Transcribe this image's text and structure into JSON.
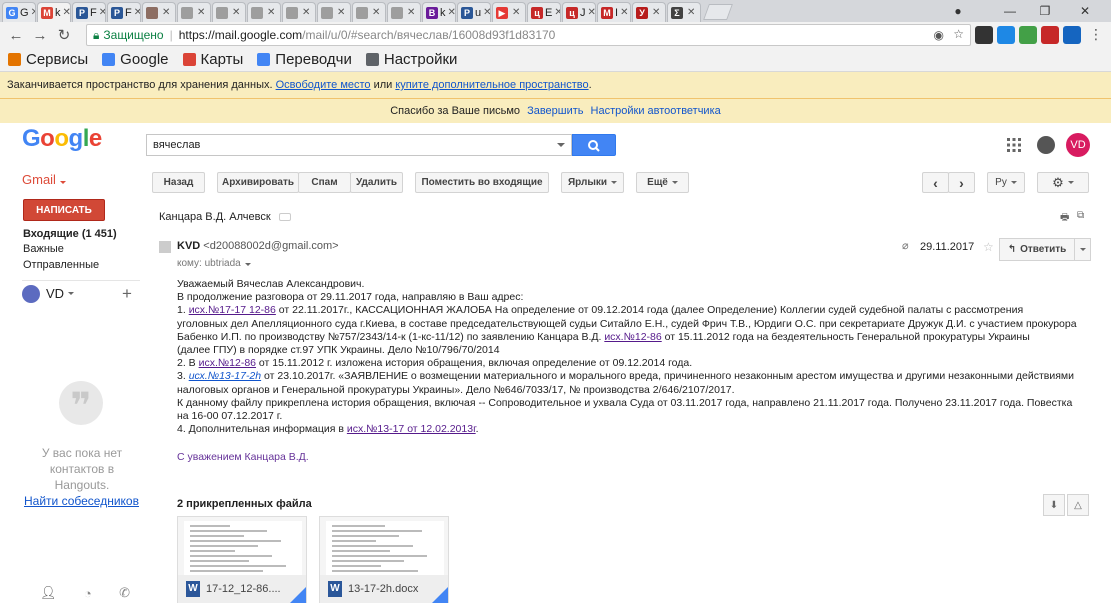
{
  "browser": {
    "tabs": [
      {
        "label": "G",
        "fav": "#4285f4",
        "glyph": "G"
      },
      {
        "label": "k",
        "fav": "#db4437",
        "glyph": "M"
      },
      {
        "label": "F",
        "fav": "#2b5797",
        "glyph": "P"
      },
      {
        "label": "F",
        "fav": "#2b5797",
        "glyph": "P"
      },
      {
        "label": "",
        "fav": "#8d6e63",
        "glyph": ""
      },
      {
        "label": "",
        "fav": "#9e9e9e",
        "glyph": ""
      },
      {
        "label": "",
        "fav": "#9e9e9e",
        "glyph": ""
      },
      {
        "label": "",
        "fav": "#9e9e9e",
        "glyph": ""
      },
      {
        "label": "",
        "fav": "#9e9e9e",
        "glyph": ""
      },
      {
        "label": "",
        "fav": "#9e9e9e",
        "glyph": ""
      },
      {
        "label": "",
        "fav": "#9e9e9e",
        "glyph": ""
      },
      {
        "label": "",
        "fav": "#9e9e9e",
        "glyph": ""
      },
      {
        "label": "k",
        "fav": "#6a1b9a",
        "glyph": "B"
      },
      {
        "label": "u",
        "fav": "#2b5797",
        "glyph": "P"
      },
      {
        "label": "",
        "fav": "#e53935",
        "glyph": "▶"
      },
      {
        "label": "E",
        "fav": "#c62828",
        "glyph": "ц"
      },
      {
        "label": "J",
        "fav": "#c62828",
        "glyph": "ц"
      },
      {
        "label": "I",
        "fav": "#c62828",
        "glyph": "M"
      },
      {
        "label": "",
        "fav": "#b71c1c",
        "glyph": "У"
      },
      {
        "label": "",
        "fav": "#424242",
        "glyph": "Σ"
      }
    ],
    "secure_label": "Защищено",
    "url_host": "https://mail.google.com",
    "url_rest": "/mail/u/0/#search/вячеслав/16008d93f1d83170",
    "bookmarks": [
      {
        "label": "Сервисы",
        "color": "#e37400"
      },
      {
        "label": "Google",
        "color": "#4285f4"
      },
      {
        "label": "Карты",
        "color": "#db4437"
      },
      {
        "label": "Переводчи",
        "color": "#4285f4"
      },
      {
        "label": "Настройки",
        "color": "#5f6368"
      }
    ]
  },
  "notices": {
    "storage_text": "Заканчивается пространство для хранения данных.",
    "storage_link1": "Освободите место",
    "storage_or": "или",
    "storage_link2": "купите дополнительное пространство",
    "storage_dot": ".",
    "thanks_text": "Спасибо за Ваше письмо",
    "thanks_finish": "Завершить",
    "thanks_settings": "Настройки автоответчика"
  },
  "header": {
    "logo": "Google",
    "search_value": "вячеслав",
    "avatar_initials": "VD"
  },
  "toolbar": {
    "gmail_label": "Gmail",
    "back": "Назад",
    "archive": "Архивировать",
    "spam": "Спам",
    "delete": "Удалить",
    "move_inbox": "Поместить во входящие",
    "labels": "Ярлыки",
    "more": "Ещё",
    "prev": "‹",
    "next": "›",
    "lang": "Ру",
    "settings": "⚙"
  },
  "sidebar": {
    "compose": "НАПИСАТЬ",
    "inbox": "Входящие (1 451)",
    "important": "Важные",
    "sent": "Отправленные",
    "account": "VD",
    "hangouts_text": "У вас пока нет контактов в Hangouts.",
    "hangouts_link": "Найти собеседников"
  },
  "message": {
    "subject": "Канцара В.Д. Алчевск",
    "sender_name": "KVD",
    "sender_email": "<d20088002d@gmail.com>",
    "to_line": "кому: ubtriada",
    "date": "29.11.2017",
    "reply": "Ответить",
    "body": [
      [
        {
          "t": "Уважаемый Вячеслав Александрович."
        }
      ],
      [
        {
          "t": "В продолжение разговора от 29.11.2017 года, направляю в Ваш адрес:"
        }
      ],
      [
        {
          "t": "1. "
        },
        {
          "t": "исх.№17-17  12-86",
          "link": "lnk"
        },
        {
          "t": " от 22.11.2017г.,  КАССАЦИОННАЯ ЖАЛОБА На определение от 09.12.2014 года (далее Определение) Коллегии судей судебной палаты с рассмотрения"
        }
      ],
      [
        {
          "t": "уголовных дел Апелляционного суда г.Киева, в составе председательствующей судьи Ситайло Е.Н., судей Фрич Т.В., Юрдиги О.С. при секретариате Дружук Д.И. с участием прокурора"
        }
      ],
      [
        {
          "t": "Бабенко И.П. по производству №757/2343/14-к (1-кс-11/12) по заявлению Канцара В.Д. "
        },
        {
          "t": "исх.№12-86",
          "link": "lnk"
        },
        {
          "t": " от 15.11.2012 года на бездеятельность Генеральной прокуратуры Украины"
        }
      ],
      [
        {
          "t": "(далее ГПУ) в порядке ст.97 УПК Украины. Дело №10/796/70/2014"
        }
      ],
      [
        {
          "t": "2. В "
        },
        {
          "t": "исх.№12-86",
          "link": "lnk"
        },
        {
          "t": " от 15.11.2012 г. изложена история обращения, включая определение от 09.12.2014 года."
        }
      ],
      [
        {
          "t": "3. "
        },
        {
          "t": "исх.№13-17-2h",
          "link": "lnk-i"
        },
        {
          "t": " от 23.10.2017г. «ЗАЯВЛЕНИЕ о возмещении материального и морального вреда, причиненного незаконным арестом имущества и другими незаконными действиями"
        }
      ],
      [
        {
          "t": "налоговых органов и Генеральной прокуратуры Украины». Дело №646/7033/17, № производства 2/646/2107/2017."
        }
      ],
      [
        {
          "t": "К данному файлу прикреплена история обращения, включая  -- Сопроводительное и ухвала Суда от 03.11.2017 года, направлено 21.11.2017 года. Получено 23.11.2017 года. Повестка"
        }
      ],
      [
        {
          "t": "на 16-00 07.12.2017 г."
        }
      ],
      [
        {
          "t": "4. Дополнительная информация в "
        },
        {
          "t": "исх.№13-17 от 12.02.2013г",
          "link": "lnk"
        },
        {
          "t": "."
        }
      ]
    ],
    "signature": "С уважением Канцара В.Д.",
    "attachments_header": "2 прикрепленных файла",
    "attachments": [
      {
        "name": "17-12_12-86...."
      },
      {
        "name": "13-17-2h.docx"
      }
    ]
  }
}
